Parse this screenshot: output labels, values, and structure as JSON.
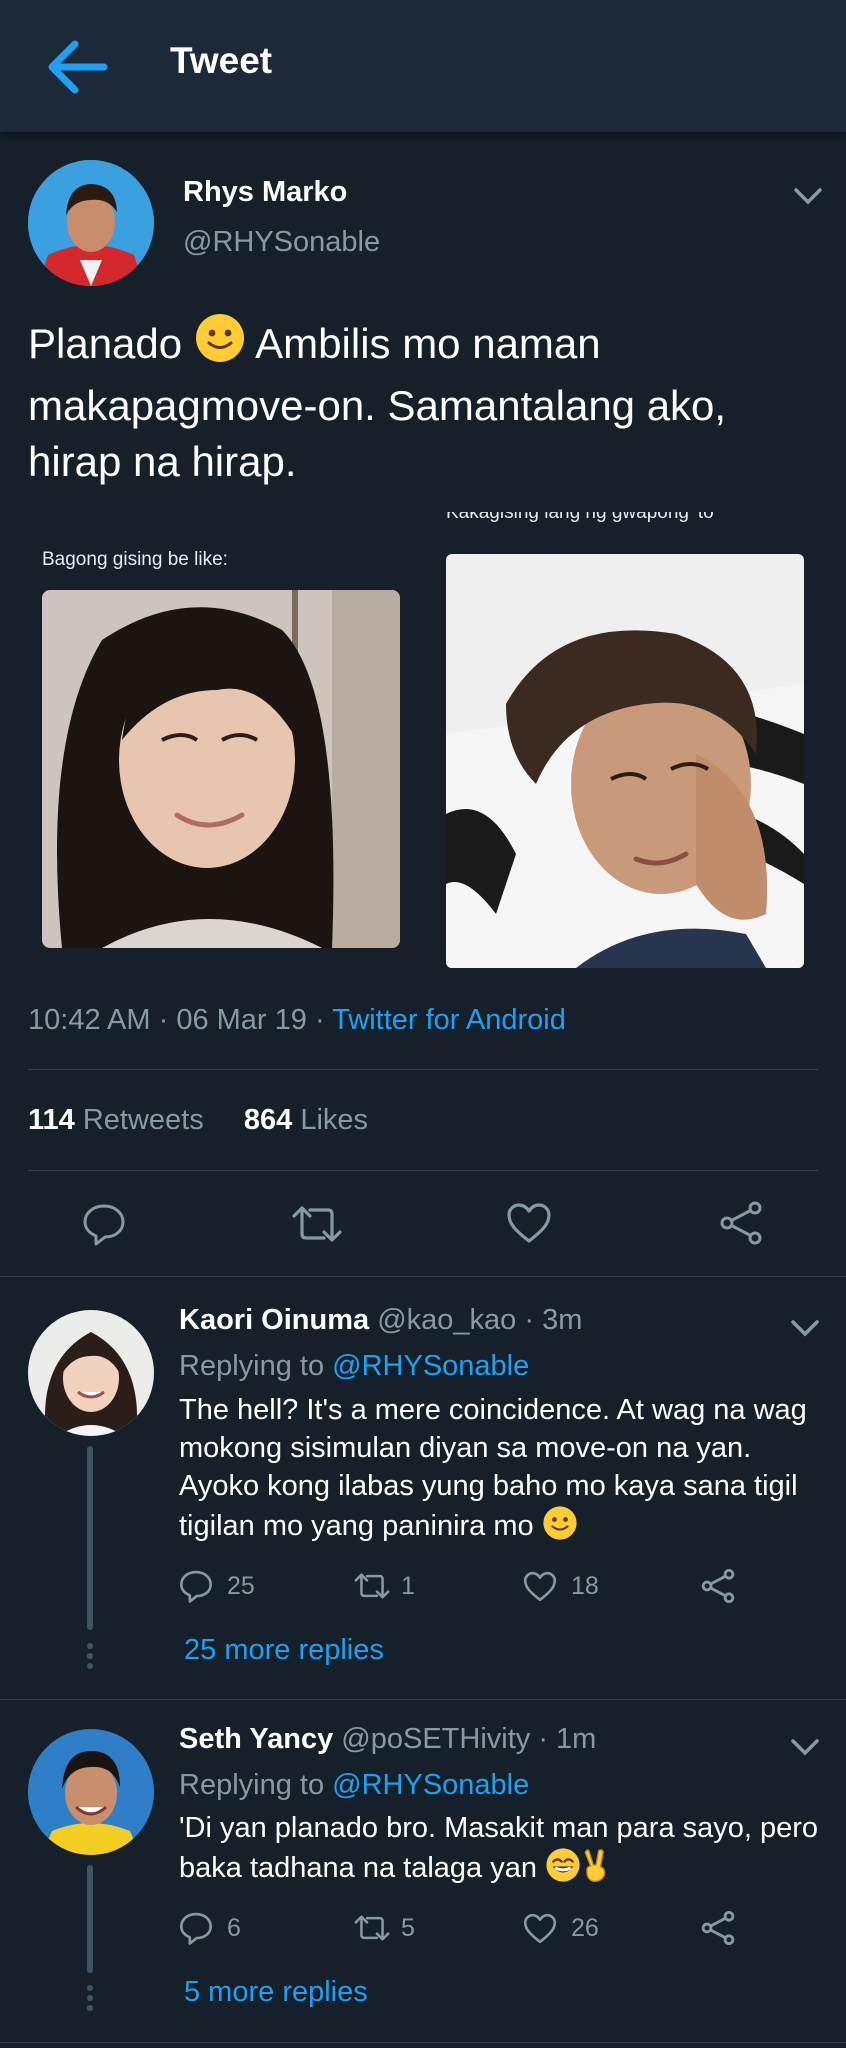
{
  "header": {
    "title": "Tweet",
    "back_icon": "arrow-left-icon"
  },
  "tweet": {
    "author_name": "Rhys Marko",
    "handle": "@RHYSonable",
    "text_part1": "Planado",
    "text_part2": "Ambilis mo naman makapagmove-on. Samantalang ako, hirap na hirap.",
    "image_left_caption": "Bagong gising be like:",
    "image_right_caption_cut": "Kakagising lang ng gwapong 'to",
    "time": "10:42 AM",
    "date": "06 Mar 19",
    "source": "Twitter for Android",
    "retweets_count": "114",
    "retweets_label": "Retweets",
    "likes_count": "864",
    "likes_label": "Likes"
  },
  "replies": [
    {
      "name": "Kaori Oinuma",
      "handle": "@kao_kao",
      "time": "· 3m",
      "replying_prefix": "Replying to",
      "replying_handle": "@RHYSonable",
      "text": "The hell? It's a mere coincidence. At wag na wag mokong sisimulan diyan sa move-on na yan. Ayoko kong ilabas yung baho mo kaya sana tigil tigilan mo yang paninira mo",
      "replies_count": "25",
      "retweets_count": "1",
      "likes_count": "18",
      "more_replies": "25 more replies"
    },
    {
      "name": "Seth Yancy",
      "handle": "@poSETHivity",
      "time": "· 1m",
      "replying_prefix": "Replying to",
      "replying_handle": "@RHYSonable",
      "text": "'Di yan planado bro. Masakit man para sayo, pero baka tadhana na talaga yan",
      "replies_count": "6",
      "retweets_count": "5",
      "likes_count": "26",
      "more_replies": "5 more replies"
    }
  ],
  "colors": {
    "background": "#15202b",
    "header": "#1c2938",
    "accent": "#1da1f2",
    "muted": "#8899a6",
    "divider": "#38444d"
  },
  "icons": [
    "arrow-left-icon",
    "chevron-down-icon",
    "reply-icon",
    "retweet-icon",
    "like-icon",
    "share-icon",
    "slightly-smiling-emoji",
    "grinning-emoji",
    "victory-hand-emoji"
  ]
}
